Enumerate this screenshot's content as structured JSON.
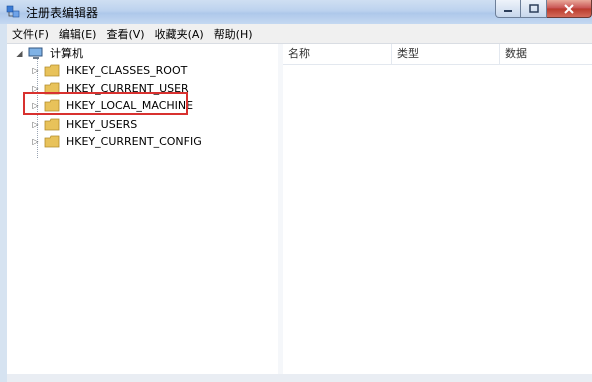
{
  "window": {
    "title": "注册表编辑器",
    "buttons": [
      "minimize",
      "maximize",
      "close"
    ]
  },
  "menu": [
    {
      "label": "文件(F)"
    },
    {
      "label": "编辑(E)"
    },
    {
      "label": "查看(V)"
    },
    {
      "label": "收藏夹(A)"
    },
    {
      "label": "帮助(H)"
    }
  ],
  "tree": {
    "root": "计算机",
    "items": [
      {
        "label": "HKEY_CLASSES_ROOT"
      },
      {
        "label": "HKEY_CURRENT_USER"
      },
      {
        "label": "HKEY_LOCAL_MACHINE",
        "highlighted": true
      },
      {
        "label": "HKEY_USERS"
      },
      {
        "label": "HKEY_CURRENT_CONFIG"
      }
    ]
  },
  "list": {
    "columns": [
      "名称",
      "类型",
      "数据"
    ]
  },
  "colors": {
    "highlight_border": "#d8312f",
    "folder": "#e8c25a"
  }
}
